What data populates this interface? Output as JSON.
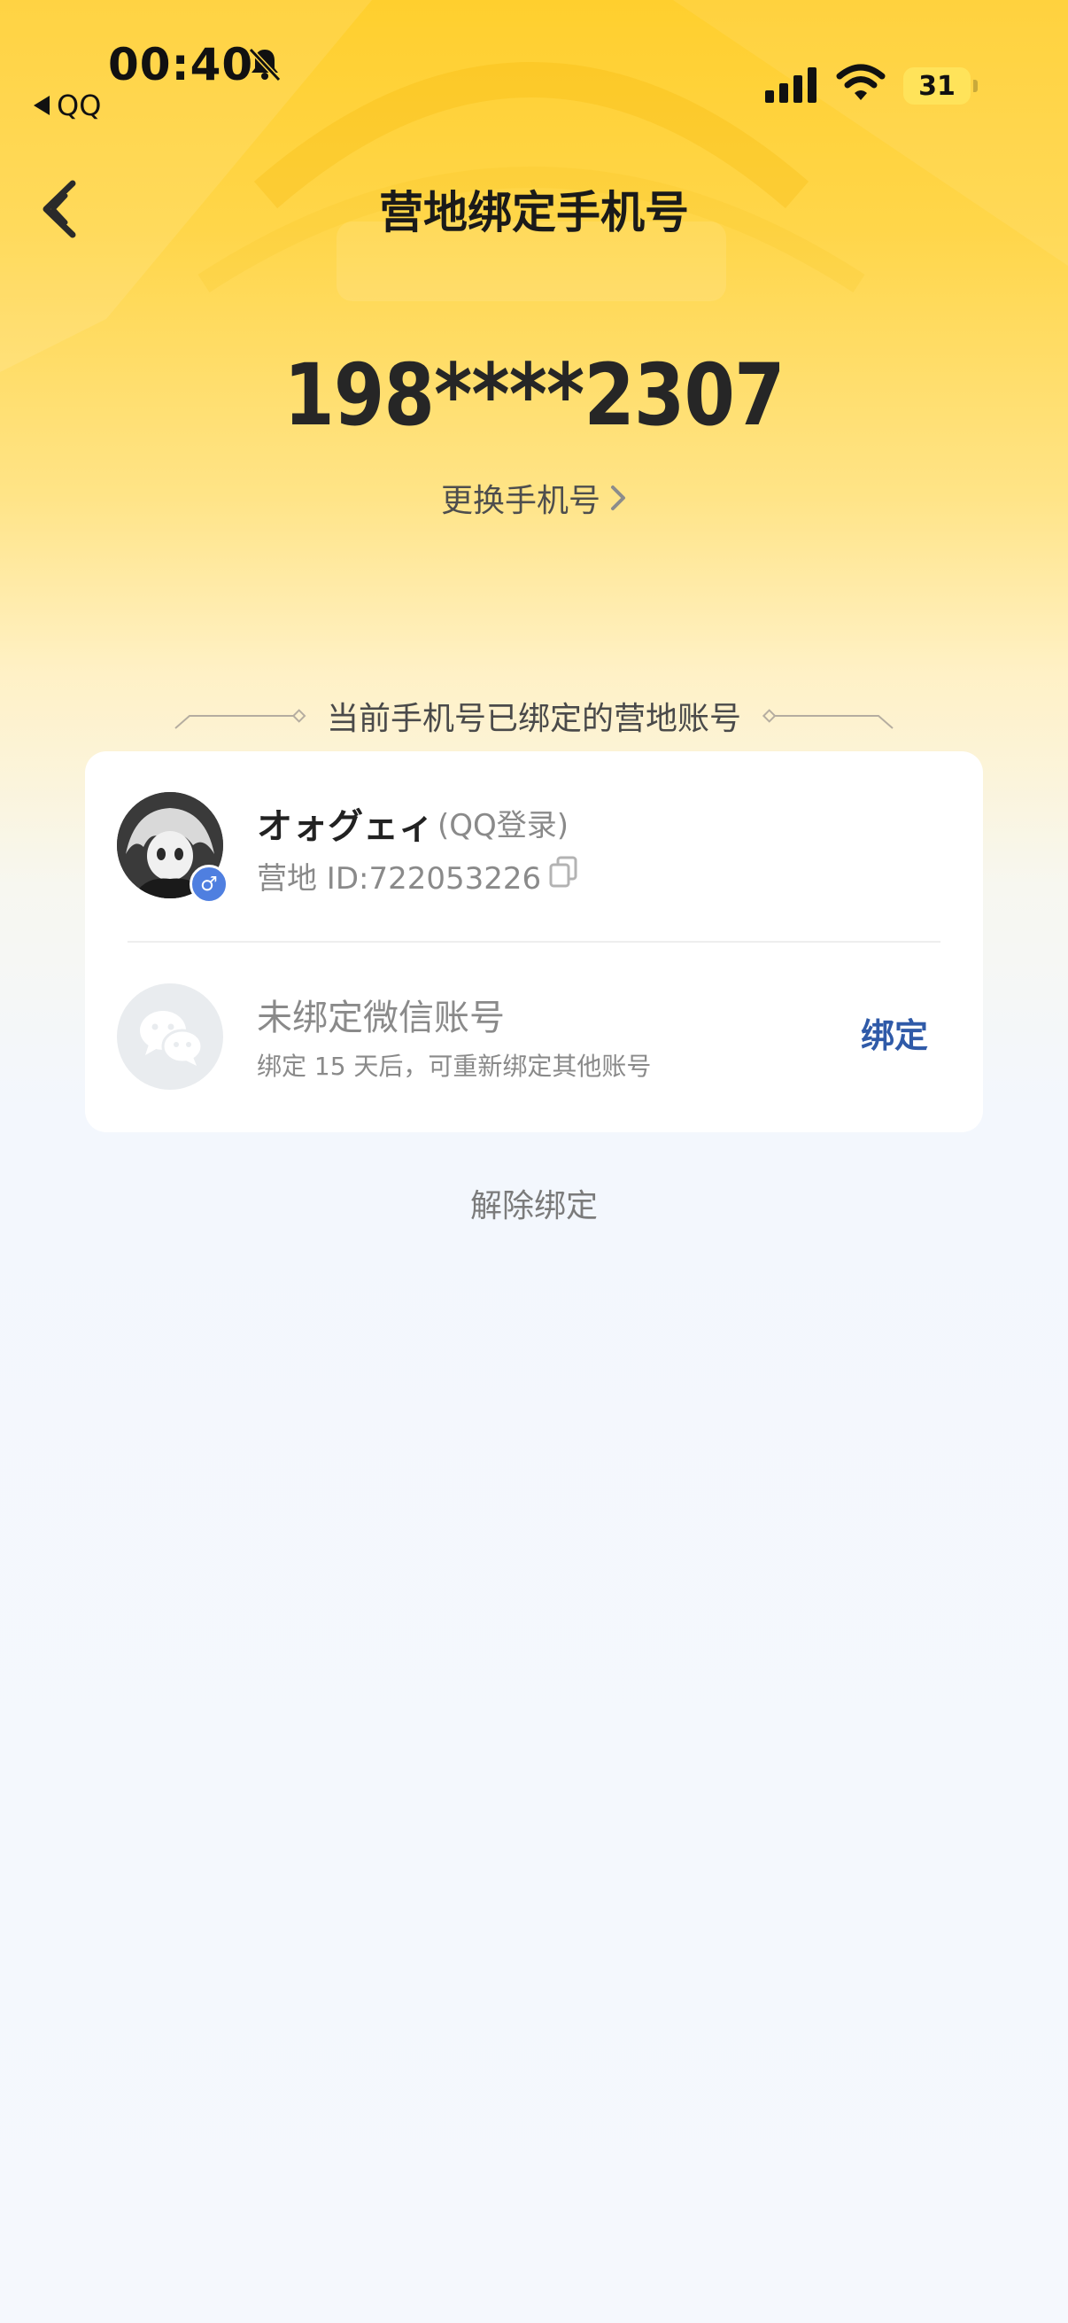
{
  "status_bar": {
    "time": "00:40",
    "back_app_label": "QQ",
    "battery": "31"
  },
  "nav": {
    "title": "营地绑定手机号"
  },
  "phone": {
    "number": "198****2307",
    "change_label": "更换手机号"
  },
  "section": {
    "title": "当前手机号已绑定的营地账号"
  },
  "accounts": {
    "qq": {
      "name": "オォグェィ",
      "login_type": "(QQ登录)",
      "id_text": "营地 ID:722053226",
      "gender_symbol": "♂"
    },
    "wechat": {
      "title": "未绑定微信账号",
      "subtitle": "绑定 15 天后，可重新绑定其他账号",
      "bind_label": "绑定"
    }
  },
  "unbind_label": "解除绑定",
  "colors": {
    "accent_blue": "#2f5aa8",
    "header_yellow": "#ffcf2e",
    "gender_blue": "#4f7fe0"
  }
}
